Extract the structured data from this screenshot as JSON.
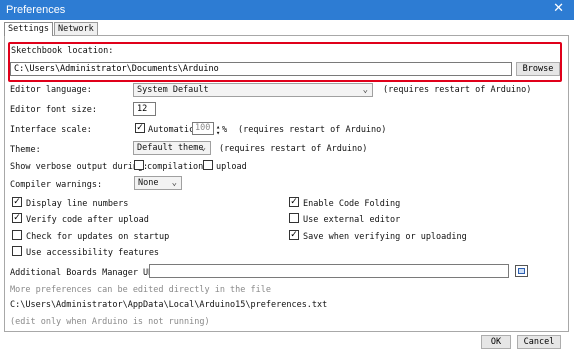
{
  "window": {
    "title": "Preferences",
    "close_glyph": "✕"
  },
  "tabs": [
    {
      "label": "Settings"
    },
    {
      "label": "Network"
    }
  ],
  "sketchbook": {
    "label": "Sketchbook location:",
    "path": "C:\\Users\\Administrator\\Documents\\Arduino",
    "browse": "Browse"
  },
  "editor_language": {
    "label": "Editor language:",
    "value": "System Default",
    "note": "(requires restart of Arduino)"
  },
  "editor_font_size": {
    "label": "Editor font size:",
    "value": "12"
  },
  "interface_scale": {
    "label": "Interface scale:",
    "auto_label": "Automatic",
    "value": "100",
    "unit": "%",
    "note": "(requires restart of Arduino)",
    "auto_checked": true
  },
  "theme": {
    "label": "Theme:",
    "value": "Default theme",
    "note": "(requires restart of Arduino)"
  },
  "verbose": {
    "label": "Show verbose output during:",
    "compilation": "compilation",
    "upload": "upload"
  },
  "compiler_warnings": {
    "label": "Compiler warnings:",
    "value": "None"
  },
  "options_left": [
    {
      "label": "Display line numbers",
      "checked": true
    },
    {
      "label": "Verify code after upload",
      "checked": true
    },
    {
      "label": "Check for updates on startup",
      "checked": false
    },
    {
      "label": "Use accessibility features",
      "checked": false
    }
  ],
  "options_right": [
    {
      "label": "Enable Code Folding",
      "checked": true
    },
    {
      "label": "Use external editor",
      "checked": false
    },
    {
      "label": "Save when verifying or uploading",
      "checked": true
    }
  ],
  "boards_manager": {
    "label": "Additional Boards Manager URLs:",
    "value": ""
  },
  "footer": {
    "note": "More preferences can be edited directly in the file",
    "path": "C:\\Users\\Administrator\\AppData\\Local\\Arduino15\\preferences.txt",
    "hint": "(edit only when Arduino is not running)"
  },
  "buttons": {
    "ok": "OK",
    "cancel": "Cancel"
  },
  "colors": {
    "titlebar": "#2d7cd3",
    "highlight_border": "#e0001a"
  },
  "icons": {
    "checkmark": "✓",
    "dropdown": "chevron-down-icon",
    "close": "close-icon",
    "boards_edit": "window-icon"
  }
}
